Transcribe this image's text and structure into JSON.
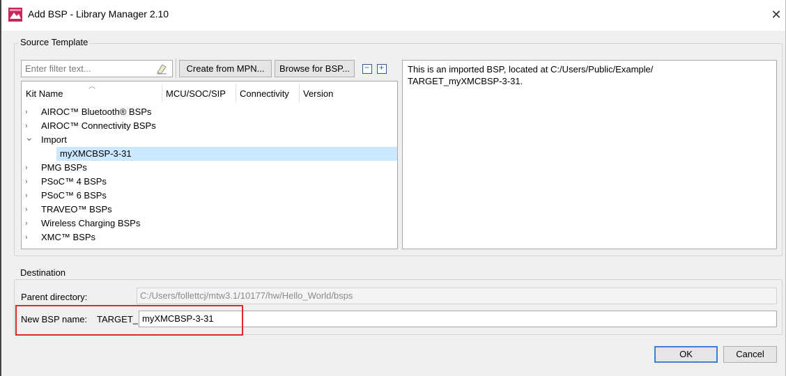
{
  "window": {
    "title": "Add BSP - Library Manager 2.10",
    "close_symbol": "✕"
  },
  "source_template": {
    "group_label": "Source Template",
    "filter_placeholder": "Enter filter text...",
    "create_from_mpn_label": "Create from MPN...",
    "browse_for_bsp_label": "Browse for BSP...",
    "collapse_all_symbol": "−",
    "expand_all_symbol": "+",
    "columns": [
      "Kit Name",
      "MCU/SOC/SIP",
      "Connectivity",
      "Version"
    ],
    "tree": [
      {
        "label": "AIROC™ Bluetooth® BSPs",
        "chevron": "›",
        "selected": false
      },
      {
        "label": "AIROC™ Connectivity BSPs",
        "chevron": "›",
        "selected": false
      },
      {
        "label": "Import",
        "chevron": "⌄",
        "selected": false
      },
      {
        "label": "myXMCBSP-3-31",
        "chevron": "",
        "selected": true
      },
      {
        "label": "PMG BSPs",
        "chevron": "›",
        "selected": false
      },
      {
        "label": "PSoC™ 4 BSPs",
        "chevron": "›",
        "selected": false
      },
      {
        "label": "PSoC™ 6 BSPs",
        "chevron": "›",
        "selected": false
      },
      {
        "label": "TRAVEO™ BSPs",
        "chevron": "›",
        "selected": false
      },
      {
        "label": "Wireless Charging BSPs",
        "chevron": "›",
        "selected": false
      },
      {
        "label": "XMC™ BSPs",
        "chevron": "›",
        "selected": false
      }
    ],
    "description": "This is an imported BSP, located at C:/Users/Public/Example/\nTARGET_myXMCBSP-3-31."
  },
  "destination": {
    "group_label": "Destination",
    "parent_directory_label": "Parent directory:",
    "parent_directory_value": "C:/Users/follettcj/mtw3.1/10177/hw/Hello_World/bsps",
    "new_bsp_name_label": "New BSP name:",
    "new_bsp_prefix": "TARGET_",
    "new_bsp_name_value": "myXMCBSP-3-31"
  },
  "footer": {
    "ok_label": "OK",
    "cancel_label": "Cancel"
  },
  "colors": {
    "selection": "#cce8ff",
    "highlight_border": "#e0262d",
    "default_button_border": "#3c7fd6"
  }
}
